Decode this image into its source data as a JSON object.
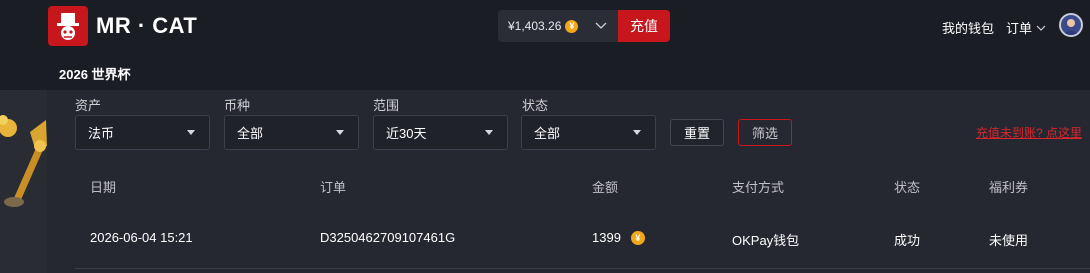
{
  "header": {
    "brand": "MR · CAT",
    "sub_brand": "2026 世界杯",
    "balance": "¥1,403.26",
    "coin_symbol": "¥",
    "topup_label": "充值",
    "wallet_label": "我的钱包",
    "orders_label": "订单",
    "accent_color": "#c8161d"
  },
  "filters": [
    {
      "label": "资产",
      "value": "法币"
    },
    {
      "label": "币种",
      "value": "全部"
    },
    {
      "label": "范围",
      "value": "近30天"
    },
    {
      "label": "状态",
      "value": "全部"
    }
  ],
  "actions": {
    "reset_label": "重置",
    "filter_label": "筛选",
    "help_link": "充值未到账? 点这里"
  },
  "table": {
    "columns": [
      "日期",
      "订单",
      "金额",
      "支付方式",
      "状态",
      "福利券"
    ],
    "rows": [
      {
        "date": "2026-06-04 15:21",
        "order": "D3250462709107461G",
        "amount": "1399",
        "coin_symbol": "¥",
        "payment": "OKPay钱包",
        "status": "成功",
        "coupon": "未使用"
      }
    ]
  }
}
